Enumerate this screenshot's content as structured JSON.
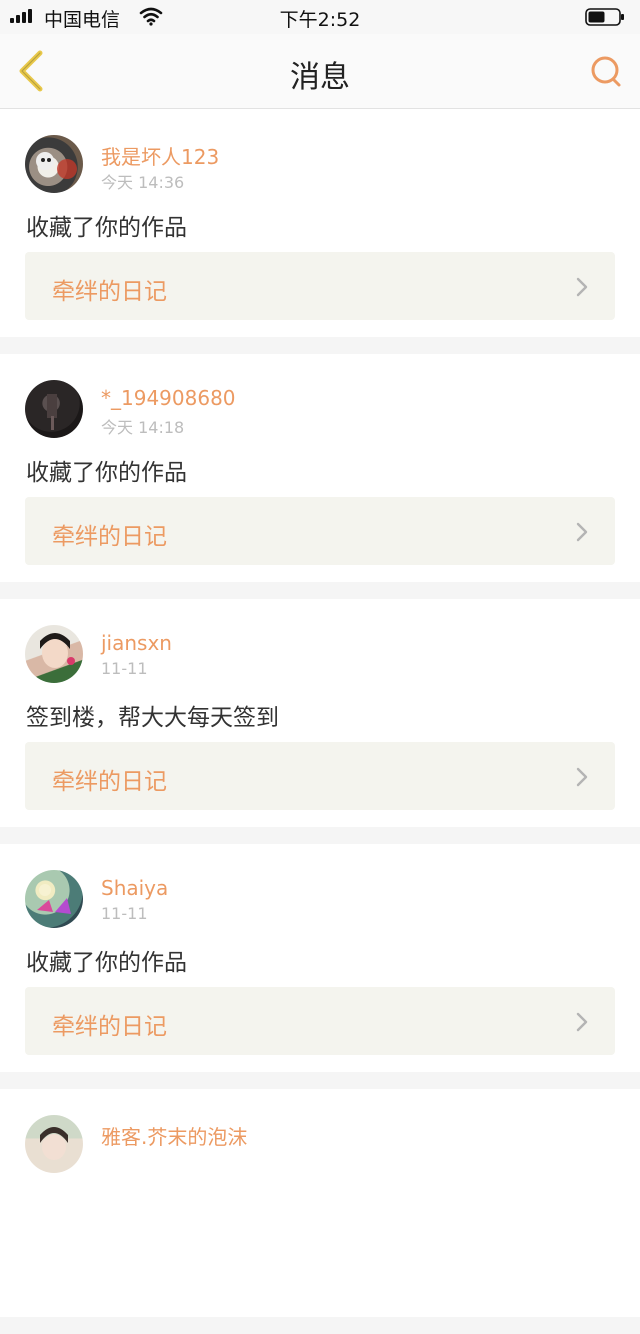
{
  "status": {
    "carrier": "中国电信",
    "time": "下午2:52"
  },
  "nav": {
    "title": "消息",
    "back_icon": "chevron-left-icon",
    "search_icon": "search-icon"
  },
  "colors": {
    "accent": "#ec9a62",
    "back_accent": "#e8c84a",
    "link_bg": "#f4f4ee"
  },
  "messages": [
    {
      "username": "我是坏人123",
      "time": "今天 14:36",
      "text": "收藏了你的作品",
      "work": "牵绊的日记"
    },
    {
      "username": "*_194908680",
      "time": "今天 14:18",
      "text": "收藏了你的作品",
      "work": "牵绊的日记"
    },
    {
      "username": "jiansxn",
      "time": "11-11",
      "text": "签到楼，帮大大每天签到",
      "work": "牵绊的日记"
    },
    {
      "username": "Shaiya",
      "time": "11-11",
      "text": "收藏了你的作品",
      "work": "牵绊的日记"
    },
    {
      "username": "雅客.芥末的泡沫",
      "time": "",
      "text": "",
      "work": ""
    }
  ]
}
